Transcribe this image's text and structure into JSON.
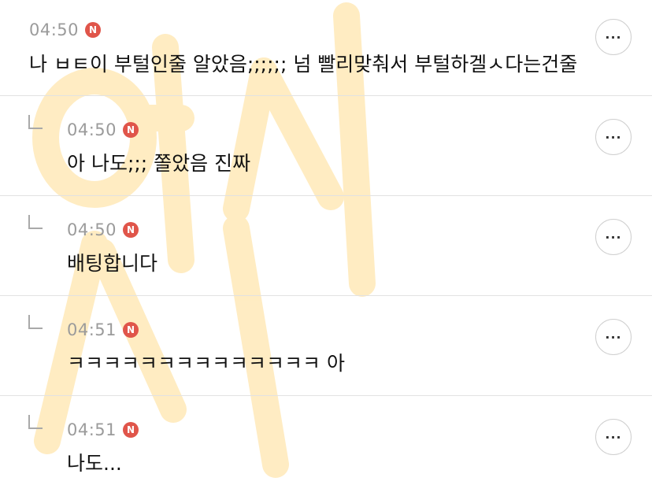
{
  "watermark": {
    "text": "여시 시",
    "color": "#ffe9b8"
  },
  "badge_color": "#e0554a",
  "comments": [
    {
      "time": "04:50",
      "badge": "N",
      "text": "나 ㅂㅌ이 부털인줄 알았음;;;;;; 넘 빨리맞춰서 부털하겔ㅅ다는건줄",
      "is_reply": false,
      "more_icon": "ellipsis-icon"
    },
    {
      "time": "04:50",
      "badge": "N",
      "text": "아 나도;;; 쫄았음 진짜",
      "is_reply": true,
      "more_icon": "ellipsis-icon"
    },
    {
      "time": "04:50",
      "badge": "N",
      "text": "배팅합니다",
      "is_reply": true,
      "more_icon": "ellipsis-icon"
    },
    {
      "time": "04:51",
      "badge": "N",
      "text": "ㅋㅋㅋㅋㅋㅋㅋㅋㅋㅋㅋㅋㅋㅋ 아",
      "is_reply": true,
      "more_icon": "ellipsis-icon"
    },
    {
      "time": "04:51",
      "badge": "N",
      "text": "나도...",
      "is_reply": true,
      "more_icon": "ellipsis-icon"
    }
  ]
}
